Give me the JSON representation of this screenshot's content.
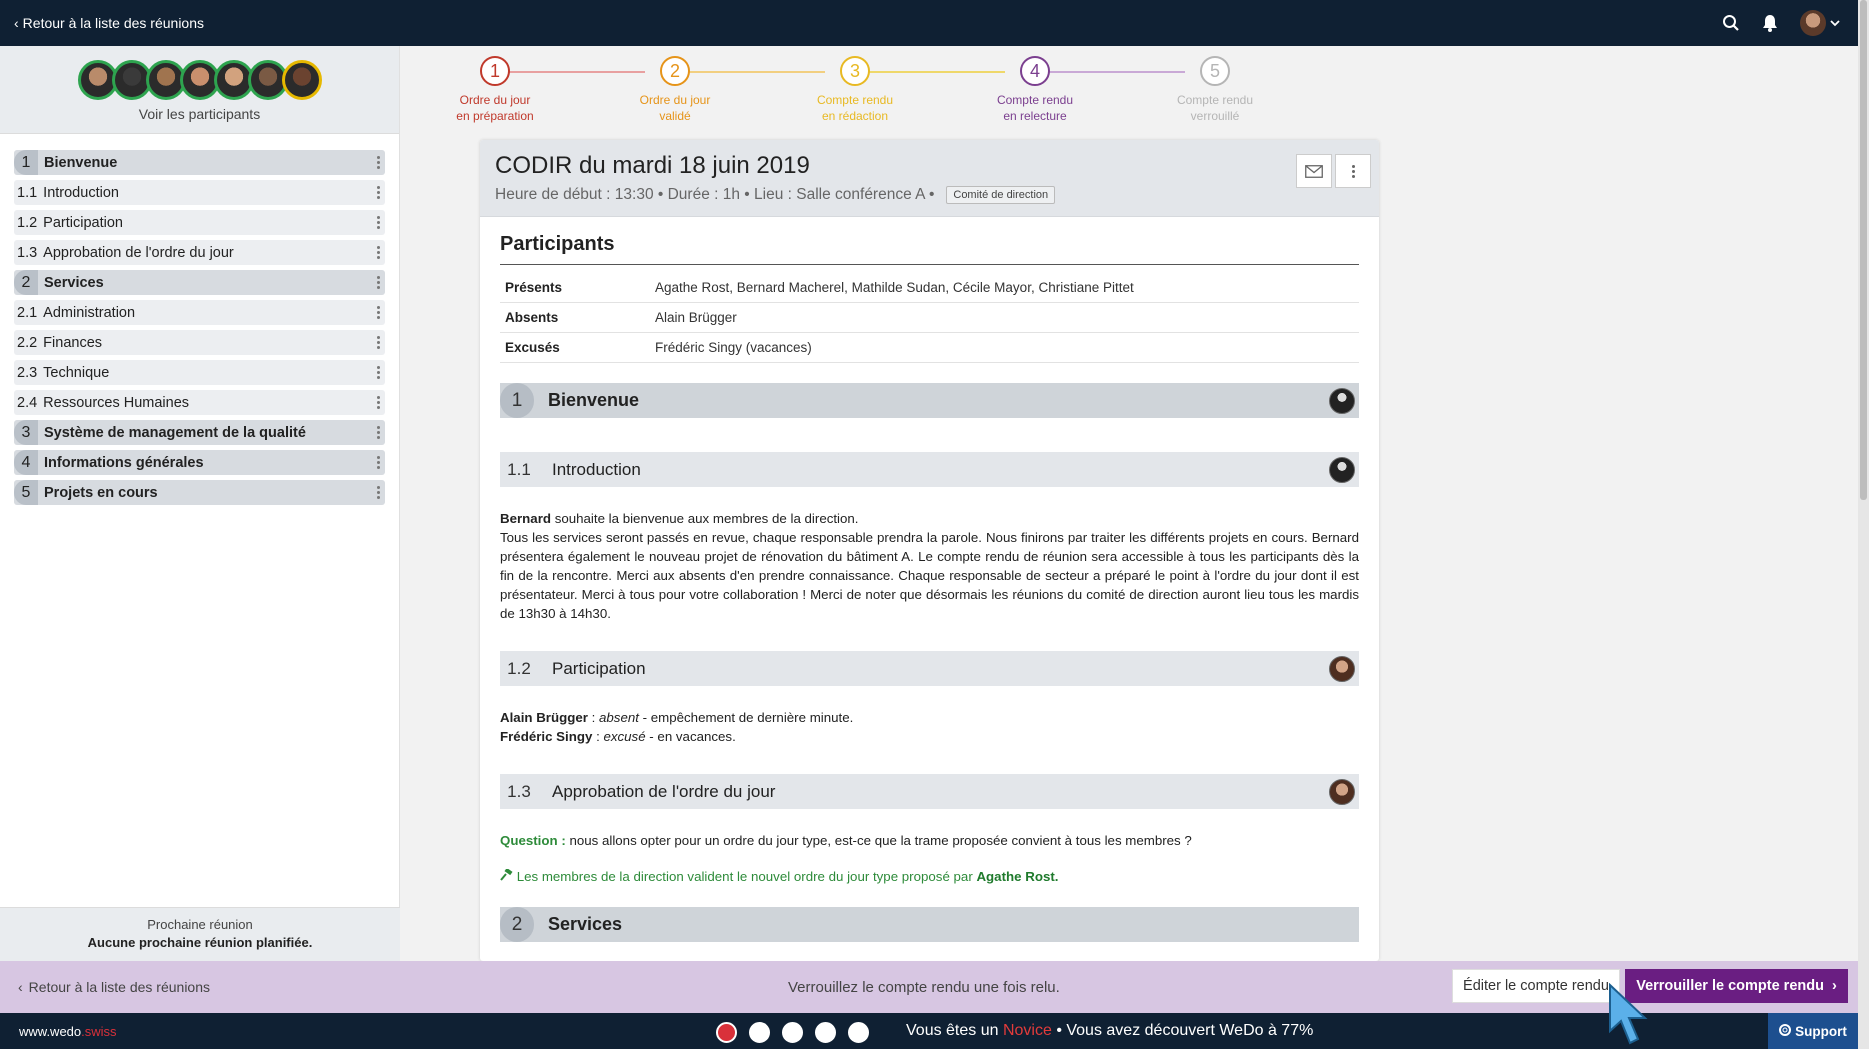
{
  "topbar": {
    "back_label": "Retour à la liste des réunions"
  },
  "sidebar": {
    "participants_link": "Voir les participants",
    "avatar_colors": [
      "#2ea44f",
      "#2ea44f",
      "#2ea44f",
      "#2ea44f",
      "#2ea44f",
      "#2ea44f",
      "#e6b800"
    ],
    "items": [
      {
        "num": "1",
        "label": "Bienvenue",
        "type": "main"
      },
      {
        "num": "1.1",
        "label": "Introduction",
        "type": "sub"
      },
      {
        "num": "1.2",
        "label": "Participation",
        "type": "sub"
      },
      {
        "num": "1.3",
        "label": "Approbation de l'ordre du jour",
        "type": "sub"
      },
      {
        "num": "2",
        "label": "Services",
        "type": "main"
      },
      {
        "num": "2.1",
        "label": "Administration",
        "type": "sub"
      },
      {
        "num": "2.2",
        "label": "Finances",
        "type": "sub"
      },
      {
        "num": "2.3",
        "label": "Technique",
        "type": "sub"
      },
      {
        "num": "2.4",
        "label": "Ressources Humaines",
        "type": "sub"
      },
      {
        "num": "3",
        "label": "Système de management de la qualité",
        "type": "main"
      },
      {
        "num": "4",
        "label": "Informations générales",
        "type": "main"
      },
      {
        "num": "5",
        "label": "Projets en cours",
        "type": "main"
      }
    ],
    "next_meeting_title": "Prochaine réunion",
    "next_meeting_value": "Aucune prochaine réunion planifiée."
  },
  "stepper": [
    {
      "num": "1",
      "line1": "Ordre du jour",
      "line2": "en préparation",
      "color": "#c0392b"
    },
    {
      "num": "2",
      "line1": "Ordre du jour",
      "line2": "validé",
      "color": "#e69419"
    },
    {
      "num": "3",
      "line1": "Compte rendu",
      "line2": "en rédaction",
      "color": "#e8b923"
    },
    {
      "num": "4",
      "line1": "Compte rendu",
      "line2": "en relecture",
      "color": "#7b3f8f"
    },
    {
      "num": "5",
      "line1": "Compte rendu",
      "line2": "verrouillé",
      "color": "#b5b5b5"
    }
  ],
  "meeting": {
    "title": "CODIR du mardi 18 juin 2019",
    "meta": "Heure de début : 13:30 • Durée : 1h • Lieu : Salle conférence A  •",
    "badge": "Comité de direction",
    "participants_heading": "Participants",
    "participants": [
      {
        "k": "Présents",
        "v": "Agathe Rost, Bernard Macherel, Mathilde Sudan, Cécile Mayor, Christiane Pittet"
      },
      {
        "k": "Absents",
        "v": "Alain Brügger"
      },
      {
        "k": "Excusés",
        "v": "Frédéric Singy (vacances)"
      }
    ],
    "s1": {
      "num": "1",
      "title": "Bienvenue"
    },
    "s11": {
      "num": "1.1",
      "title": "Introduction"
    },
    "s11_name": "Bernard",
    "s11_first": " souhaite la bienvenue aux membres de la direction.",
    "s11_body": "Tous les services seront passés en revue, chaque responsable prendra la parole. Nous finirons par traiter les différents projets en cours. Bernard présentera également le nouveau projet de rénovation du bâtiment A. Le compte rendu de réunion sera accessible à tous les participants dès la fin de la rencontre. Merci aux absents d'en prendre connaissance. Chaque responsable de secteur a préparé le point à l'ordre du jour dont il est présentateur. Merci à tous pour votre collaboration ! Merci de noter que désormais les réunions du comité de direction auront lieu tous les mardis de 13h30 à 14h30.",
    "s12": {
      "num": "1.2",
      "title": "Participation"
    },
    "s12_l1_name": "Alain Brügger",
    "s12_l1_sep": " : ",
    "s12_l1_status": "absent",
    "s12_l1_rest": " - empêchement de dernière minute.",
    "s12_l2_name": "Frédéric Singy",
    "s12_l2_sep": " : ",
    "s12_l2_status": "excusé",
    "s12_l2_rest": " - en vacances.",
    "s13": {
      "num": "1.3",
      "title": "Approbation de l'ordre du jour"
    },
    "s13_q_label": "Question :",
    "s13_q_text": " nous allons opter pour un ordre du jour type, est-ce que la trame proposée convient à tous les membres ?",
    "s13_decision": " Les membres de la direction valident le nouvel ordre du jour type proposé par ",
    "s13_decision_name": "Agathe Rost.",
    "s2": {
      "num": "2",
      "title": "Services"
    }
  },
  "action_bar": {
    "back_label": "Retour à la liste des réunions",
    "message": "Verrouillez le compte rendu une fois relu.",
    "edit_label": "Éditer le compte rendu",
    "lock_label": "Verrouiller le compte rendu"
  },
  "footer": {
    "brand_main": "www.wedo",
    "brand_accent": ".swiss",
    "level_prefix": "Vous êtes un ",
    "level_name": "Novice",
    "level_suffix": " • Vous avez découvert WeDo à 77%",
    "support_label": "Support"
  }
}
